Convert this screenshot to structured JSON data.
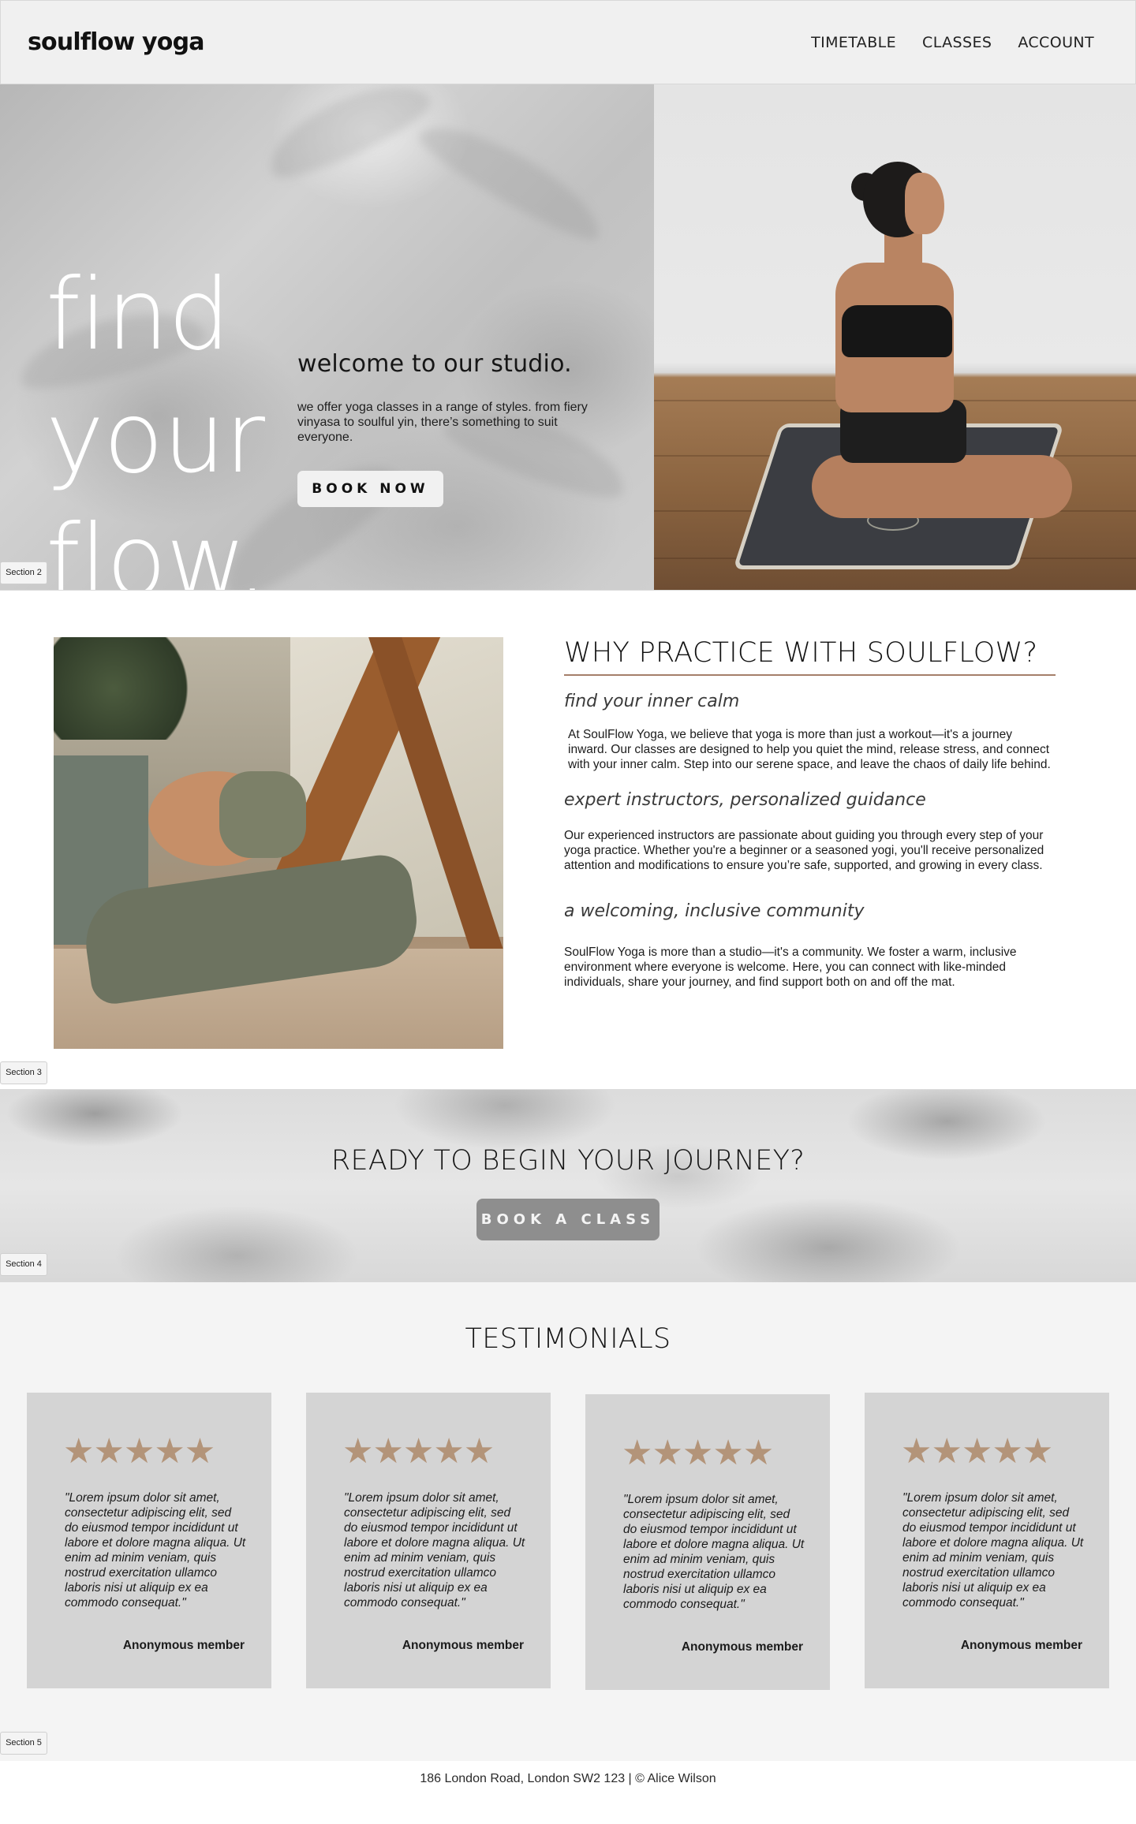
{
  "header": {
    "logo": "soulflow yoga",
    "nav": [
      "TIMETABLE",
      "CLASSES",
      "ACCOUNT"
    ]
  },
  "hero": {
    "title_lines": [
      "find",
      "your",
      "flow."
    ],
    "welcome": "welcome to our studio.",
    "description": "we offer yoga classes in a range of styles. from fiery vinyasa to soulful yin, there’s something to suit everyone.",
    "button": "BOOK NOW",
    "section_tag": "Section 2"
  },
  "about": {
    "heading": "WHY PRACTICE WITH SOULFLOW?",
    "blocks": [
      {
        "subheading": "find your inner calm",
        "text": "At SoulFlow Yoga, we believe that yoga is more than just a workout—it's a journey inward. Our classes are designed to help you quiet the mind, release stress, and connect with your inner calm. Step into our serene space, and leave the chaos of daily life behind."
      },
      {
        "subheading": "expert instructors, personalized guidance",
        "text": "Our experienced instructors are passionate about guiding you through every step of your yoga practice. Whether you're a beginner or a seasoned yogi, you'll receive personalized attention and modifications to ensure you’re safe, supported, and growing in every class."
      },
      {
        "subheading": "a welcoming, inclusive community",
        "text": "SoulFlow Yoga is more than a studio—it's a community. We foster a warm, inclusive environment where everyone is welcome. Here, you can connect with like-minded individuals, share your journey, and find support both on and off the mat."
      }
    ],
    "section_tag": "Section 3"
  },
  "cta": {
    "heading": "READY TO BEGIN YOUR JOURNEY?",
    "button": "BOOK A CLASS",
    "section_tag": "Section 4"
  },
  "testimonials": {
    "heading": "TESTIMONIALS",
    "cards": [
      {
        "stars": "★★★★★",
        "quote": "\"Lorem ipsum dolor sit amet, consectetur adipiscing elit, sed do eiusmod tempor incididunt ut labore et dolore magna aliqua. Ut enim ad minim veniam, quis nostrud exercitation ullamco laboris nisi ut aliquip ex ea commodo consequat.\"",
        "author": "Anonymous member"
      },
      {
        "stars": "★★★★★",
        "quote": "\"Lorem ipsum dolor sit amet, consectetur adipiscing elit, sed do eiusmod tempor incididunt ut labore et dolore magna aliqua. Ut enim ad minim veniam, quis nostrud exercitation ullamco laboris nisi ut aliquip ex ea commodo consequat.\"",
        "author": "Anonymous member"
      },
      {
        "stars": "★★★★★",
        "quote": "\"Lorem ipsum dolor sit amet, consectetur adipiscing elit, sed do eiusmod tempor incididunt ut labore et dolore magna aliqua. Ut enim ad minim veniam, quis nostrud exercitation ullamco laboris nisi ut aliquip ex ea commodo consequat.\"",
        "author": "Anonymous member"
      },
      {
        "stars": "★★★★★",
        "quote": "\"Lorem ipsum dolor sit amet, consectetur adipiscing elit, sed do eiusmod tempor incididunt ut labore et dolore magna aliqua. Ut enim ad minim veniam, quis nostrud exercitation ullamco laboris nisi ut aliquip ex ea commodo consequat.\"",
        "author": "Anonymous member"
      }
    ],
    "section_tag": "Section 5"
  },
  "footer": {
    "text": "186 London Road, London SW2 123 | © Alice Wilson"
  },
  "colors": {
    "accent_rule": "#a57f6a",
    "star": "#b39479",
    "card_bg": "#d4d4d4",
    "cta_button": "#8e8e8e"
  }
}
